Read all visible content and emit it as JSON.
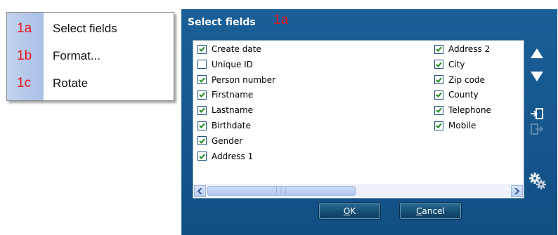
{
  "context_menu": {
    "items": [
      {
        "num": "1a",
        "label": "Select fields"
      },
      {
        "num": "1b",
        "label": "Format..."
      },
      {
        "num": "1c",
        "label": "Rotate"
      }
    ]
  },
  "dialog": {
    "title": "Select fields",
    "title_tag": "1a",
    "fields_left": [
      {
        "label": "Create date",
        "checked": true
      },
      {
        "label": "Unique ID",
        "checked": false
      },
      {
        "label": "Person number",
        "checked": true
      },
      {
        "label": "Firstname",
        "checked": true
      },
      {
        "label": "Lastname",
        "checked": true
      },
      {
        "label": "Birthdate",
        "checked": true
      },
      {
        "label": "Gender",
        "checked": true
      },
      {
        "label": "Address 1",
        "checked": true
      }
    ],
    "fields_right": [
      {
        "label": "Address 2",
        "checked": true
      },
      {
        "label": "City",
        "checked": true
      },
      {
        "label": "Zip code",
        "checked": true
      },
      {
        "label": "County",
        "checked": true
      },
      {
        "label": "Telephone",
        "checked": true
      },
      {
        "label": "Mobile",
        "checked": true
      }
    ],
    "tools": [
      "arrow-up-icon",
      "arrow-down-icon",
      "import-icon",
      "export-icon",
      "settings-gear-icon"
    ],
    "ok_label": {
      "first": "O",
      "rest": "K"
    },
    "cancel_label": {
      "first": "C",
      "rest": "ancel"
    }
  },
  "colors": {
    "marker_red": "#e8141c",
    "dialog_blue": "#165a92",
    "check_green": "#1e8c1e"
  }
}
